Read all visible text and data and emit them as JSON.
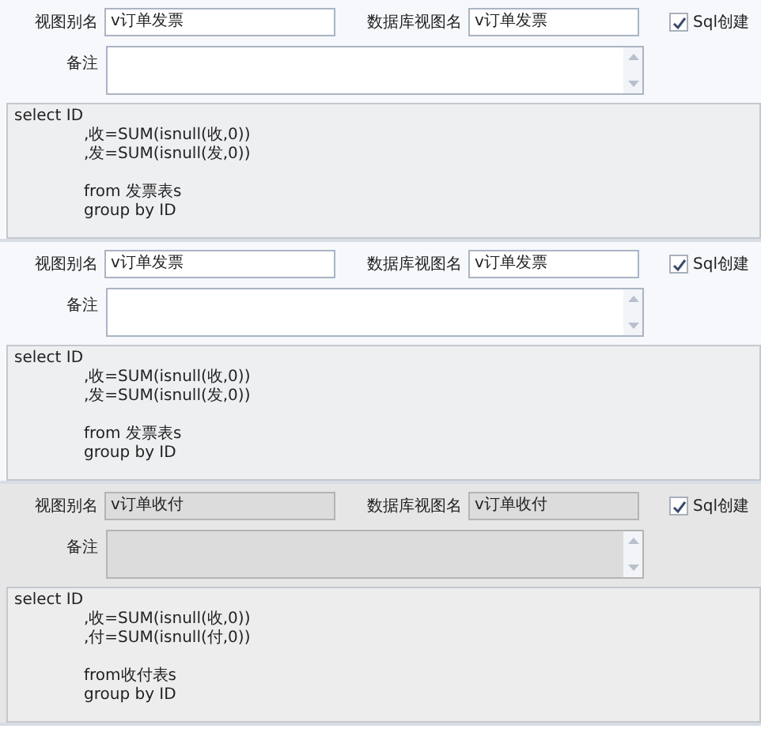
{
  "panels": [
    {
      "disabled": false,
      "alias_label": "视图别名",
      "alias_value": "v订单发票",
      "db_label": "数据库视图名",
      "db_value": "v订单发票",
      "sql_create": {
        "label": "Sql创建",
        "checked": true
      },
      "remark_label": "备注",
      "sql_lines": [
        {
          "text": "select ID",
          "indent": false,
          "gap_before": false
        },
        {
          "text": ",收=SUM(isnull(收,0))",
          "indent": true,
          "gap_before": false
        },
        {
          "text": ",发=SUM(isnull(发,0))",
          "indent": true,
          "gap_before": false
        },
        {
          "text": "from 发票表s",
          "indent": true,
          "gap_before": true
        },
        {
          "text": "group by ID",
          "indent": true,
          "gap_before": false
        }
      ]
    },
    {
      "disabled": false,
      "alias_label": "视图别名",
      "alias_value": "v订单发票",
      "db_label": "数据库视图名",
      "db_value": "v订单发票",
      "sql_create": {
        "label": "Sql创建",
        "checked": true
      },
      "remark_label": "备注",
      "sql_lines": [
        {
          "text": "select ID",
          "indent": false,
          "gap_before": false
        },
        {
          "text": ",收=SUM(isnull(收,0))",
          "indent": true,
          "gap_before": false
        },
        {
          "text": ",发=SUM(isnull(发,0))",
          "indent": true,
          "gap_before": false
        },
        {
          "text": "from 发票表s",
          "indent": true,
          "gap_before": true
        },
        {
          "text": "group by ID",
          "indent": true,
          "gap_before": false
        }
      ]
    },
    {
      "disabled": true,
      "alias_label": "视图别名",
      "alias_value": "v订单收付",
      "db_label": "数据库视图名",
      "db_value": "v订单收付",
      "sql_create": {
        "label": "Sql创建",
        "checked": true
      },
      "remark_label": "备注",
      "sql_lines": [
        {
          "text": "select ID",
          "indent": false,
          "gap_before": false
        },
        {
          "text": ",收=SUM(isnull(收,0))",
          "indent": true,
          "gap_before": false
        },
        {
          "text": ",付=SUM(isnull(付,0))",
          "indent": true,
          "gap_before": false
        },
        {
          "text": "from收付表s",
          "indent": true,
          "gap_before": true
        },
        {
          "text": "group by ID",
          "indent": true,
          "gap_before": false
        }
      ]
    }
  ]
}
